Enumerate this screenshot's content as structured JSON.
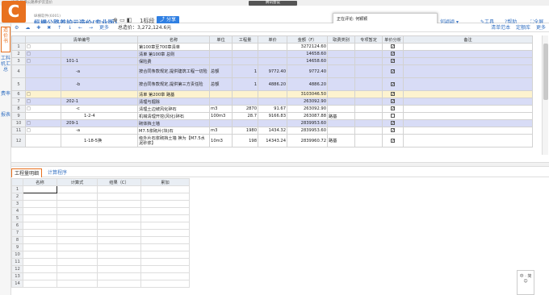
{
  "window": {
    "title": "纵横-纵横公路养护云造价",
    "meeting": "腾讯会议"
  },
  "header": {
    "company": "纵横软件(6001)",
    "app_title": "纵横公路养护云造价(专业版)",
    "toolbar_icons": "⊕ ▭ ◧",
    "project_name": "1标段",
    "share_label": "分享",
    "review_text": "正在评论: 何颖颖",
    "user_label": "何颖颖",
    "tools_label": "工具",
    "help_label": "帮助",
    "screen_label": "全屏"
  },
  "left_tabs": [
    "造价书",
    "工料机汇总",
    "费率",
    "报表"
  ],
  "toolbar": {
    "icons": [
      "⚙",
      "☁",
      "✚",
      "✖",
      "↑",
      "↓",
      "←",
      "→"
    ],
    "more_label": "更多",
    "total_label": "总造价：",
    "total_value": "3,272,124.6元",
    "right_items": [
      "清单范本",
      "定额库",
      "更多"
    ]
  },
  "grid": {
    "headers": [
      "清单编号",
      "名称",
      "单位",
      "工程量",
      "单价",
      "金额（F）",
      "取费类别",
      "专项暂定",
      "单价分析",
      "备注"
    ],
    "rows": [
      {
        "n": "1",
        "code": "",
        "tree": "□",
        "name": "第100章至700章清单",
        "unit": "",
        "qty": "",
        "price": "",
        "amt": "3272124.60",
        "fee": "",
        "sp": "",
        "chk": "✓",
        "note": "",
        "style": "white"
      },
      {
        "n": "2",
        "code": "",
        "tree": "□",
        "name": "清单 第100章 总则",
        "unit": "",
        "qty": "",
        "price": "",
        "amt": "14658.60",
        "fee": "",
        "sp": "",
        "chk": "✓",
        "note": "",
        "style": "blue"
      },
      {
        "n": "3",
        "code": "101-1",
        "tree": "□",
        "name": "保险费",
        "unit": "",
        "qty": "",
        "price": "",
        "amt": "14658.60",
        "fee": "",
        "sp": "",
        "chk": "✓",
        "note": "",
        "style": "blue"
      },
      {
        "n": "4",
        "code": "-a",
        "tree": "",
        "name": "按合同条款规定,提供建筑工程一切险",
        "unit": "总额",
        "qty": "1",
        "price": "9772.40",
        "amt": "9772.40",
        "fee": "",
        "sp": "",
        "chk": "✓",
        "note": "",
        "style": "blue",
        "tall": true
      },
      {
        "n": "5",
        "code": "-b",
        "tree": "",
        "name": "按合同条款规定,提供第三方责任险",
        "unit": "总额",
        "qty": "1",
        "price": "4886.20",
        "amt": "4886.20",
        "fee": "",
        "sp": "",
        "chk": "✓",
        "note": "",
        "style": "blue",
        "tall": true
      },
      {
        "n": "6",
        "code": "",
        "tree": "□",
        "name": "清单 第200章 路基",
        "unit": "",
        "qty": "",
        "price": "",
        "amt": "3103046.50",
        "fee": "",
        "sp": "",
        "chk": "✓",
        "note": "",
        "style": "sel"
      },
      {
        "n": "7",
        "code": "202-1",
        "tree": "□",
        "name": "清理与掘除",
        "unit": "",
        "qty": "",
        "price": "",
        "amt": "263092.90",
        "fee": "",
        "sp": "",
        "chk": "✓",
        "note": "",
        "style": "blue"
      },
      {
        "n": "8",
        "code": "-c",
        "tree": "□",
        "name": "清理土边坡风化碎石",
        "unit": "m3",
        "qty": "2870",
        "price": "91.67",
        "amt": "263092.90",
        "fee": "",
        "sp": "",
        "chk": "✓",
        "note": "",
        "style": "white"
      },
      {
        "n": "9",
        "code": "1-2-4",
        "tree": "",
        "name": "机械清理开挖(风化)碎石",
        "unit": "100m3",
        "qty": "28.7",
        "price": "9166.83",
        "amt": "263087.88",
        "fee": "路基",
        "sp": "",
        "chk": "",
        "note": "",
        "style": "white"
      },
      {
        "n": "10",
        "code": "209-1",
        "tree": "□",
        "name": "砌体挡土墙",
        "unit": "",
        "qty": "",
        "price": "",
        "amt": "2839953.60",
        "fee": "",
        "sp": "",
        "chk": "✓",
        "note": "",
        "style": "blue"
      },
      {
        "n": "11",
        "code": "-a",
        "tree": "□",
        "name": "M7.5浆砌片(块)石",
        "unit": "m3",
        "qty": "1980",
        "price": "1434.32",
        "amt": "2839953.60",
        "fee": "",
        "sp": "",
        "chk": "✓",
        "note": "",
        "style": "white"
      },
      {
        "n": "12",
        "code": "1-18-5换",
        "tree": "",
        "name": "级外片石浆砌挡土墙 换为【M7.5水泥砂浆】",
        "unit": "10m3",
        "qty": "198",
        "price": "14343.24",
        "amt": "2839960.72",
        "fee": "路基",
        "sp": "",
        "chk": "✓",
        "note": "",
        "style": "white",
        "tall": true
      }
    ]
  },
  "subtabs": [
    "工程量明细",
    "计算程序"
  ],
  "grid2": {
    "headers": [
      "名称",
      "计算式",
      "结果（C）",
      "累加"
    ],
    "row_numbers": [
      "1",
      "2",
      "3",
      "4",
      "5",
      "6",
      "7",
      "8",
      "9",
      "10",
      "11",
      "12",
      "13",
      "14"
    ]
  },
  "side_panel": {
    "text": "中 · 简 ☺"
  }
}
